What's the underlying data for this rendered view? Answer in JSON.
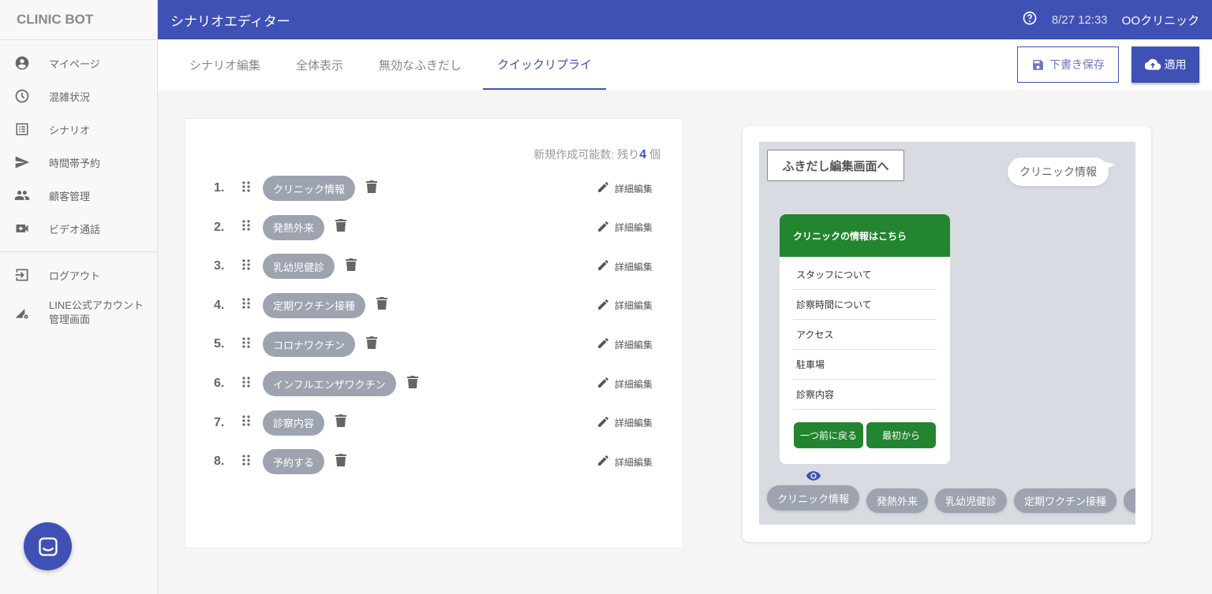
{
  "sidebar": {
    "logo": "CLINIC BOT",
    "items": [
      {
        "label": "マイページ",
        "icon": "account-circle-icon"
      },
      {
        "label": "混雑状況",
        "icon": "clock-icon"
      },
      {
        "label": "シナリオ",
        "icon": "list-icon"
      },
      {
        "label": "時間帯予約",
        "icon": "send-icon"
      },
      {
        "label": "顧客管理",
        "icon": "people-icon"
      },
      {
        "label": "ビデオ通話",
        "icon": "video-icon"
      }
    ],
    "bottom": [
      {
        "label": "ログアウト",
        "icon": "logout-icon"
      },
      {
        "label": "LINE公式アカウント",
        "label2": "管理画面",
        "icon": "admin-settings-icon"
      }
    ]
  },
  "header": {
    "title": "シナリオエディター",
    "datetime": "8/27 12:33",
    "clinic": "OOクリニック"
  },
  "tabs": [
    {
      "label": "シナリオ編集"
    },
    {
      "label": "全体表示"
    },
    {
      "label": "無効なふきだし"
    },
    {
      "label": "クイックリプライ",
      "active": true
    }
  ],
  "actions": {
    "save": "下書き保存",
    "apply": "適用"
  },
  "list": {
    "remain_prefix": "新規作成可能数: 残り",
    "remain_count": "4",
    "remain_suffix": " 個",
    "edit_label": "詳細編集",
    "items": [
      {
        "num": "1.",
        "label": "クリニック情報"
      },
      {
        "num": "2.",
        "label": "発熱外来"
      },
      {
        "num": "3.",
        "label": "乳幼児健診"
      },
      {
        "num": "4.",
        "label": "定期ワクチン接種"
      },
      {
        "num": "5.",
        "label": "コロナワクチン"
      },
      {
        "num": "6.",
        "label": "インフルエンザワクチン"
      },
      {
        "num": "7.",
        "label": "診察内容"
      },
      {
        "num": "8.",
        "label": "予約する"
      }
    ]
  },
  "preview": {
    "to_edit": "ふきだし編集画面へ",
    "user_bubble": "クリニック情報",
    "flex_title": "クリニックの情報はこちら",
    "flex_items": [
      "スタッフについて",
      "診察時間について",
      "アクセス",
      "駐車場",
      "診察内容"
    ],
    "flex_buttons": [
      "一つ前に戻る",
      "最初から"
    ],
    "quick_replies": [
      "クリニック情報",
      "発熱外来",
      "乳幼児健診",
      "定期ワクチン接種"
    ]
  },
  "colors": {
    "primary": "#3f51b5",
    "green": "#23852f",
    "chip": "#9ea3b0"
  }
}
